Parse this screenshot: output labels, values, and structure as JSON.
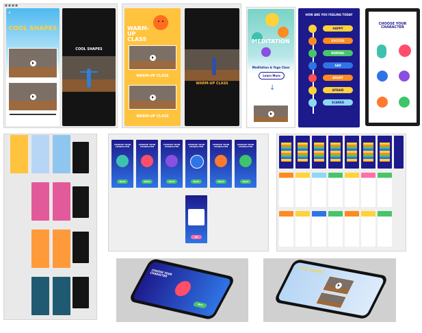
{
  "row1": {
    "screen1": {
      "back_arrow": "‹",
      "title": "COOL SHAPES"
    },
    "screen2": {
      "caption": "COOL SHAPES"
    },
    "screen3": {
      "title": "WARM-UP CLASS",
      "caption1": "WARM-UP CLASS",
      "caption2": "WARM-UP CLASS"
    },
    "screen4": {
      "caption": "WARM-UP CLASS"
    },
    "screen5": {
      "title": "MEDITATION",
      "subtitle": "Meditation & Yoga Class",
      "button": "Learn More"
    },
    "screen6": {
      "title": "HOW ARE YOU FEELING TODAY",
      "moods": [
        "HAPPY",
        "EXCITED",
        "NORMAL",
        "SAD",
        "ANGRY",
        "AFRAID",
        "SCARED"
      ]
    },
    "screen7": {
      "title": "CHOOSE YOUR CHARACTER"
    }
  },
  "row2": {
    "choose_screens": [
      {
        "title": "CHOOSE YOUR CHARACTER",
        "color": "#3fc1b0",
        "button": "Next"
      },
      {
        "title": "CHOOSE YOUR CHARACTER",
        "color": "#ff4e6a",
        "button": "Next"
      },
      {
        "title": "CHOOSE YOUR CHARACTER",
        "color": "#8a4fe0",
        "button": "Next"
      },
      {
        "title": "CHOOSE YOUR CHARACTER",
        "color": "#2f74e6",
        "button": "Next"
      },
      {
        "title": "CHOOSE YOUR CHARACTER",
        "color": "#ff7a2e",
        "button": "Next"
      },
      {
        "title": "CHOOSE YOUR CHARACTER",
        "color": "#3ec46b",
        "button": "Next"
      }
    ],
    "dialog_screen": {
      "button": "OK"
    }
  },
  "row3": {
    "phone1": {
      "title": "CHOOSE YOUR CHARACTER",
      "button": "Next"
    },
    "phone2": {
      "title": "COOL SHAPES"
    }
  },
  "colors": {
    "navy": "#1d1a8c",
    "yellow": "#ffd23a",
    "orange": "#ff8a1f",
    "sky": "#8fd6f5",
    "green": "#49c46a",
    "pink": "#ff6fa8"
  }
}
